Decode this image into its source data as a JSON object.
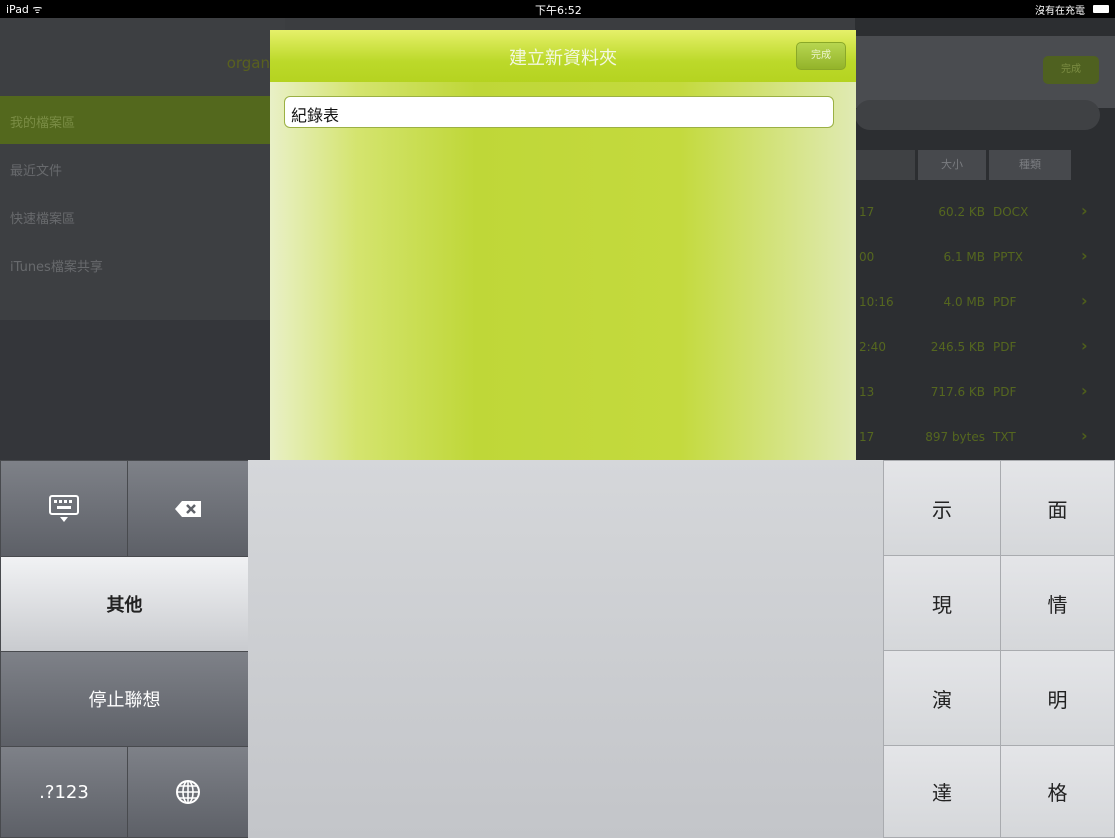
{
  "status_bar": {
    "device": "iPad ᯤ",
    "time": "下午6:52",
    "charge": "沒有在充電"
  },
  "sidebar": {
    "title": "organ",
    "items": [
      {
        "label": "我的檔案區",
        "active": true
      },
      {
        "label": "最近文件",
        "active": false
      },
      {
        "label": "快速檔案區",
        "active": false
      },
      {
        "label": "iTunes檔案共享",
        "active": false
      }
    ]
  },
  "file_list": {
    "top_button": "完成",
    "headers": {
      "size": "大小",
      "type": "種類"
    },
    "rows": [
      {
        "time": "17",
        "size": "60.2 KB",
        "type": "DOCX"
      },
      {
        "time": "00",
        "size": "6.1 MB",
        "type": "PPTX"
      },
      {
        "time": "10:16",
        "size": "4.0 MB",
        "type": "PDF"
      },
      {
        "time": "2:40",
        "size": "246.5 KB",
        "type": "PDF"
      },
      {
        "time": "13",
        "size": "717.6 KB",
        "type": "PDF"
      },
      {
        "time": "17",
        "size": "897 bytes",
        "type": "TXT"
      }
    ],
    "arrow": "›"
  },
  "dialog": {
    "title": "建立新資料夾",
    "done_button": "完成",
    "input_value": "紀錄表"
  },
  "keyboard": {
    "dismiss_icon": "keyboard-dismiss-icon",
    "delete_icon": "delete-icon",
    "other_label": "其他",
    "stop_assoc_label": "停止聯想",
    "numbers_label": ".?123",
    "globe_icon": "globe-icon",
    "candidates": [
      "示",
      "面",
      "現",
      "情",
      "演",
      "明",
      "達",
      "格"
    ]
  },
  "colors": {
    "accent_green": "#bfd738",
    "sidebar_active": "#53681d"
  }
}
